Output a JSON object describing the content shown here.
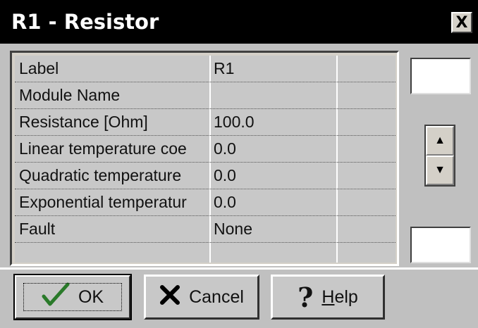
{
  "window": {
    "title": "R1 - Resistor",
    "close_label": "X"
  },
  "properties": [
    {
      "name": "Label",
      "value": "R1"
    },
    {
      "name": "Module Name",
      "value": ""
    },
    {
      "name": "Resistance [Ohm]",
      "value": "100.0"
    },
    {
      "name": "Linear temperature coe",
      "value": "0.0"
    },
    {
      "name": "Quadratic temperature",
      "value": "0.0"
    },
    {
      "name": "Exponential temperatur",
      "value": "0.0"
    },
    {
      "name": "Fault",
      "value": "None"
    }
  ],
  "buttons": {
    "ok_label": "OK",
    "cancel_label": "Cancel",
    "help_label": "Help"
  },
  "icons": {
    "ok": "check-icon",
    "cancel": "x-icon",
    "help": "question-icon",
    "spin_up": "up-arrow-icon",
    "spin_down": "down-arrow-icon"
  },
  "colors": {
    "titlebar": "#000000",
    "dialog_bg": "#c0c0c0",
    "check_green": "#2a7a2a"
  }
}
